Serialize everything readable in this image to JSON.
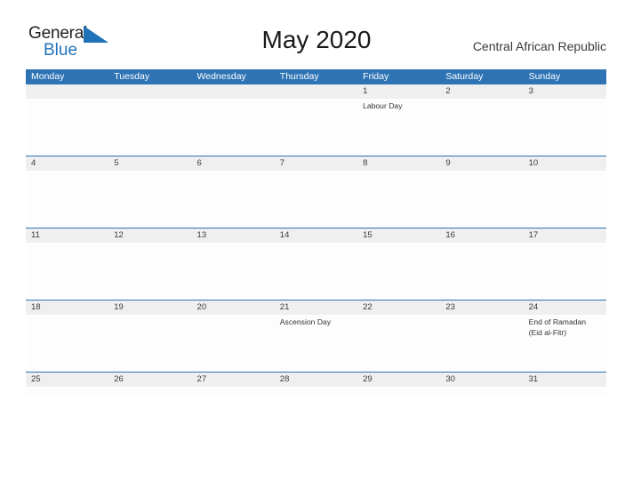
{
  "brand": {
    "name_top": "General",
    "name_bottom": "Blue",
    "color_top": "#231f20",
    "color_bottom": "#1f71b8",
    "flag_icon": "triangle-flag-icon"
  },
  "header": {
    "title": "May 2020",
    "country": "Central African Republic"
  },
  "colors": {
    "header_blue": "#2e74b5",
    "date_band": "#efefef",
    "cell_bg": "#fdfdfd",
    "text": "#333333"
  },
  "calendar": {
    "day_headers": [
      "Monday",
      "Tuesday",
      "Wednesday",
      "Thursday",
      "Friday",
      "Saturday",
      "Sunday"
    ],
    "weeks": [
      {
        "days": [
          {
            "num": "",
            "events": []
          },
          {
            "num": "",
            "events": []
          },
          {
            "num": "",
            "events": []
          },
          {
            "num": "",
            "events": []
          },
          {
            "num": "1",
            "events": [
              "Labour Day"
            ]
          },
          {
            "num": "2",
            "events": []
          },
          {
            "num": "3",
            "events": []
          }
        ]
      },
      {
        "days": [
          {
            "num": "4",
            "events": []
          },
          {
            "num": "5",
            "events": []
          },
          {
            "num": "6",
            "events": []
          },
          {
            "num": "7",
            "events": []
          },
          {
            "num": "8",
            "events": []
          },
          {
            "num": "9",
            "events": []
          },
          {
            "num": "10",
            "events": []
          }
        ]
      },
      {
        "days": [
          {
            "num": "11",
            "events": []
          },
          {
            "num": "12",
            "events": []
          },
          {
            "num": "13",
            "events": []
          },
          {
            "num": "14",
            "events": []
          },
          {
            "num": "15",
            "events": []
          },
          {
            "num": "16",
            "events": []
          },
          {
            "num": "17",
            "events": []
          }
        ]
      },
      {
        "days": [
          {
            "num": "18",
            "events": []
          },
          {
            "num": "19",
            "events": []
          },
          {
            "num": "20",
            "events": []
          },
          {
            "num": "21",
            "events": [
              "Ascension Day"
            ]
          },
          {
            "num": "22",
            "events": []
          },
          {
            "num": "23",
            "events": []
          },
          {
            "num": "24",
            "events": [
              "End of Ramadan",
              "(Eid al-Fitr)"
            ]
          }
        ]
      },
      {
        "days": [
          {
            "num": "25",
            "events": []
          },
          {
            "num": "26",
            "events": []
          },
          {
            "num": "27",
            "events": []
          },
          {
            "num": "28",
            "events": []
          },
          {
            "num": "29",
            "events": []
          },
          {
            "num": "30",
            "events": []
          },
          {
            "num": "31",
            "events": []
          }
        ]
      }
    ]
  }
}
